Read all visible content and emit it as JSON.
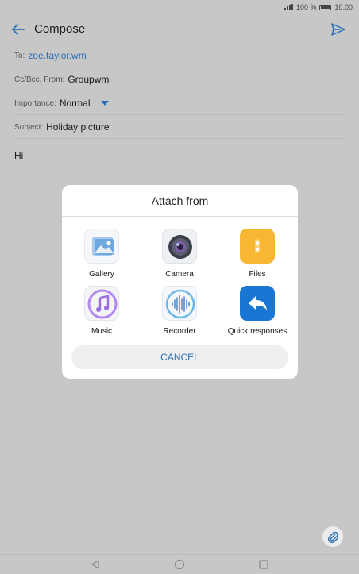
{
  "status": {
    "battery": "100 %",
    "time": "10:00"
  },
  "header": {
    "title": "Compose"
  },
  "fields": {
    "to_label": "To:",
    "to_value": "zoe.taylor.wm",
    "ccbcc_label": "Cc/Bcc, From:",
    "ccbcc_value": "Groupwm",
    "importance_label": "Importance:",
    "importance_value": "Normal",
    "subject_label": "Subject:",
    "subject_value": "Holiday picture"
  },
  "body": {
    "text": "Hi"
  },
  "dialog": {
    "title": "Attach from",
    "items": [
      {
        "label": "Gallery",
        "icon": "gallery-icon"
      },
      {
        "label": "Camera",
        "icon": "camera-icon"
      },
      {
        "label": "Files",
        "icon": "files-icon"
      },
      {
        "label": "Music",
        "icon": "music-icon"
      },
      {
        "label": "Recorder",
        "icon": "recorder-icon"
      },
      {
        "label": "Quick responses",
        "icon": "quick-responses-icon"
      }
    ],
    "cancel_label": "CANCEL"
  },
  "colors": {
    "accent": "#2a6fb8",
    "overlay": "#c7c7c7",
    "files": "#f7b733",
    "quick": "#1976d2"
  }
}
